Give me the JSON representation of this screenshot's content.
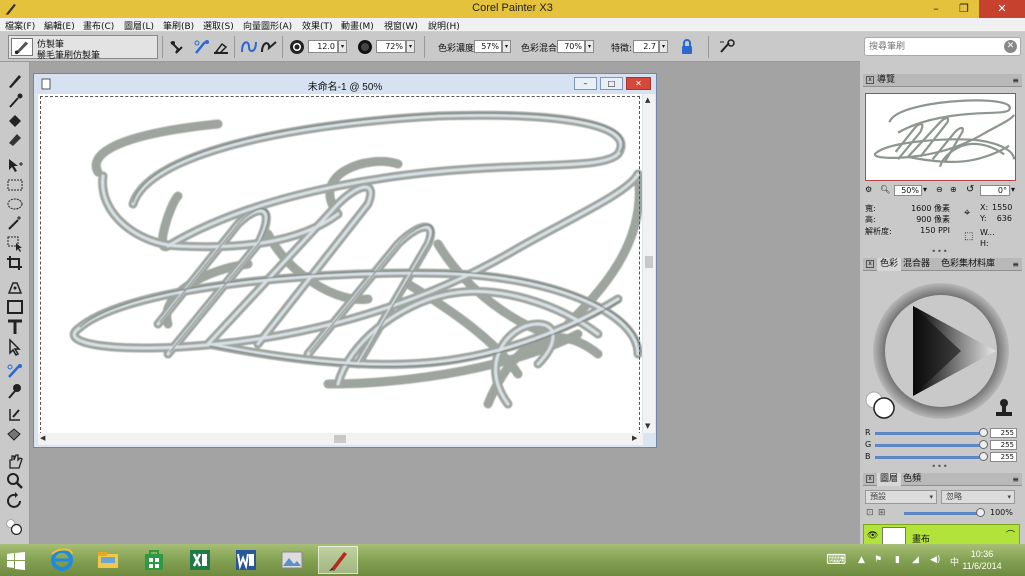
{
  "window": {
    "title": "Corel Painter X3",
    "minimize": "–",
    "restore": "❐",
    "close": "✕"
  },
  "menu": [
    {
      "label": "檔案(F)"
    },
    {
      "label": "編輯(E)"
    },
    {
      "label": "畫布(C)"
    },
    {
      "label": "圖層(L)"
    },
    {
      "label": "筆刷(B)"
    },
    {
      "label": "選取(S)"
    },
    {
      "label": "向量圖形(A)"
    },
    {
      "label": "效果(T)"
    },
    {
      "label": "動畫(M)"
    },
    {
      "label": "視窗(W)"
    },
    {
      "label": "說明(H)"
    }
  ],
  "propbar": {
    "brush_category": "仿製筆",
    "brush_variant": "鬃毛筆刷仿製筆",
    "size_value": "12.0",
    "opacity_value": "72%",
    "resaturation_label": "色彩濃度:",
    "resaturation_value": "57%",
    "bleed_label": "色彩混合:",
    "bleed_value": "70%",
    "feature_label": "特徵:",
    "feature_value": "2.7"
  },
  "search": {
    "placeholder": "搜尋筆刷",
    "clear": "✕"
  },
  "document": {
    "title": "未命名-1 @ 50%",
    "minimize": "–",
    "restore": "□",
    "close": "✕"
  },
  "navigator": {
    "tab": "導覽",
    "zoom_value": "50%",
    "rotation_value": "0°",
    "width_label": "寬:",
    "width_value": "1600 像素",
    "height_label": "高:",
    "height_value": "900 像素",
    "resolution_label": "解析度:",
    "resolution_value": "150 PPI",
    "x_label": "X:",
    "x_value": "1550",
    "y_label": "Y:",
    "y_value": "636",
    "w_label": "W...",
    "h_label": "H:"
  },
  "color_panel": {
    "tabs": [
      {
        "label": "色彩"
      },
      {
        "label": "混合器"
      },
      {
        "label": "色彩集材料庫"
      }
    ],
    "r_label": "R",
    "r_value": "255",
    "g_label": "G",
    "g_value": "255",
    "b_label": "B",
    "b_value": "255"
  },
  "layers_panel": {
    "tabs": [
      {
        "label": "圖層"
      },
      {
        "label": "色頻"
      }
    ],
    "composite_method": "預設",
    "preserve": "忽略",
    "opacity_value": "100%",
    "layer_name": "畫布"
  },
  "taskbar": {
    "time": "10:36",
    "date": "11/6/2014"
  },
  "colors": {
    "title_bar": "#e5c23b",
    "panel_bg": "#c9c9c9",
    "workspace": "#a3a3a3",
    "layer_selected": "#b1e33a",
    "slider": "#5c86c4"
  }
}
